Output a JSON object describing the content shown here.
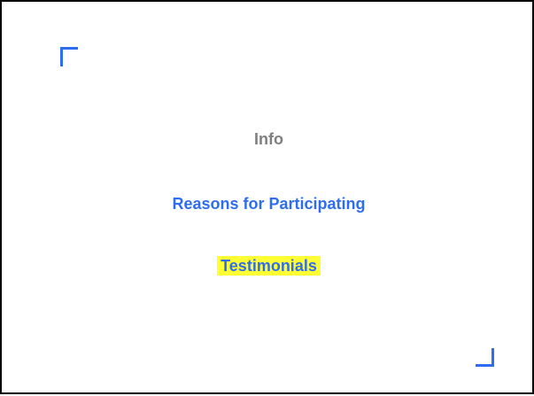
{
  "menu": {
    "items": [
      {
        "label": "Info",
        "state": "disabled"
      },
      {
        "label": "Reasons for Participating",
        "state": "link"
      },
      {
        "label": "Testimonials",
        "state": "highlighted"
      }
    ]
  },
  "colors": {
    "accent": "#2f6df0",
    "muted": "#7f7f7f",
    "highlight": "#ffff33",
    "border": "#000000"
  }
}
